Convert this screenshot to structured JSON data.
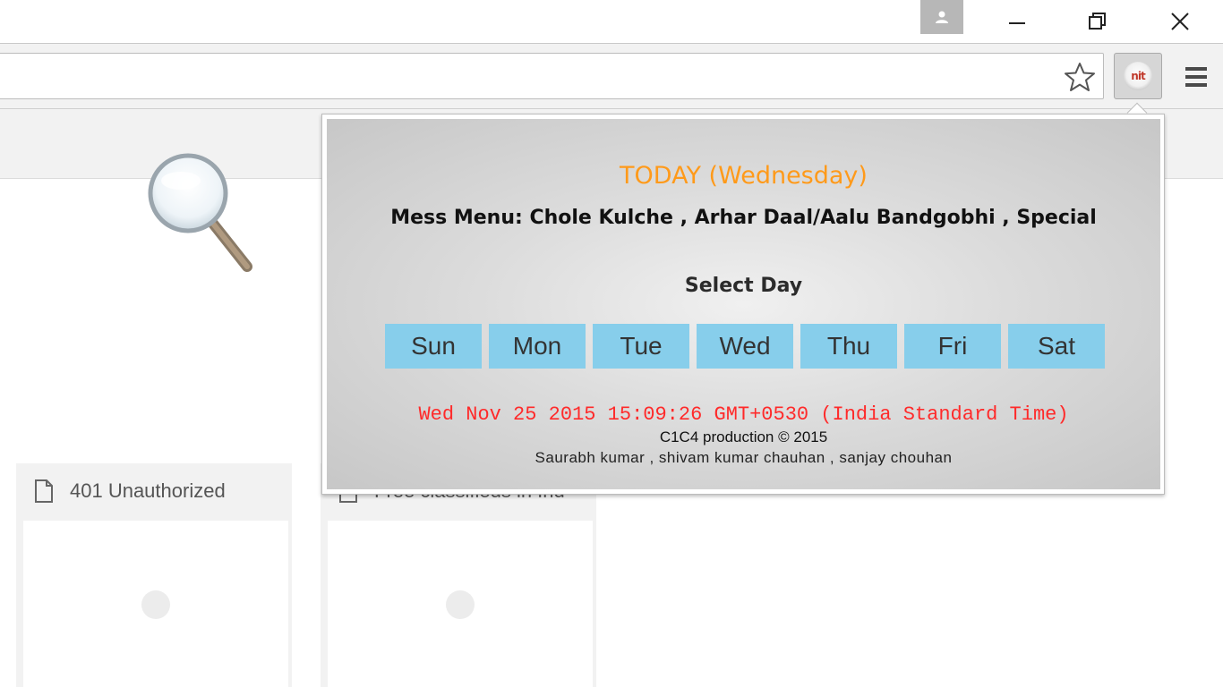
{
  "window": {
    "profile_icon": "person-icon",
    "minimize_icon": "minimize-icon",
    "maximize_icon": "restore-icon",
    "close_icon": "close-icon"
  },
  "toolbar": {
    "omnibox_value": "",
    "bookmark_icon": "star-icon",
    "extension_label": "nit",
    "menu_icon": "hamburger-icon"
  },
  "ntp": {
    "search_icon": "magnifier-icon",
    "tiles": [
      {
        "title": "401 Unauthorized",
        "icon": "page-icon"
      },
      {
        "title": "Free classifieds in Ind",
        "icon": "page-icon"
      }
    ]
  },
  "popup": {
    "today": "TODAY (Wednesday)",
    "mess_menu": "Mess Menu: Chole Kulche , Arhar Daal/Aalu Bandgobhi , Special",
    "select_day_label": "Select Day",
    "days": [
      "Sun",
      "Mon",
      "Tue",
      "Wed",
      "Thu",
      "Fri",
      "Sat"
    ],
    "datetime": "Wed Nov 25 2015 15:09:26 GMT+0530 (India Standard Time)",
    "credit": "C1C4 production © 2015",
    "authors": "Saurabh kumar , shivam kumar chauhan , sanjay chouhan"
  },
  "colors": {
    "today": "#ff9a1a",
    "day_button_bg": "#87ceeb",
    "datetime": "#ff2a2a"
  }
}
